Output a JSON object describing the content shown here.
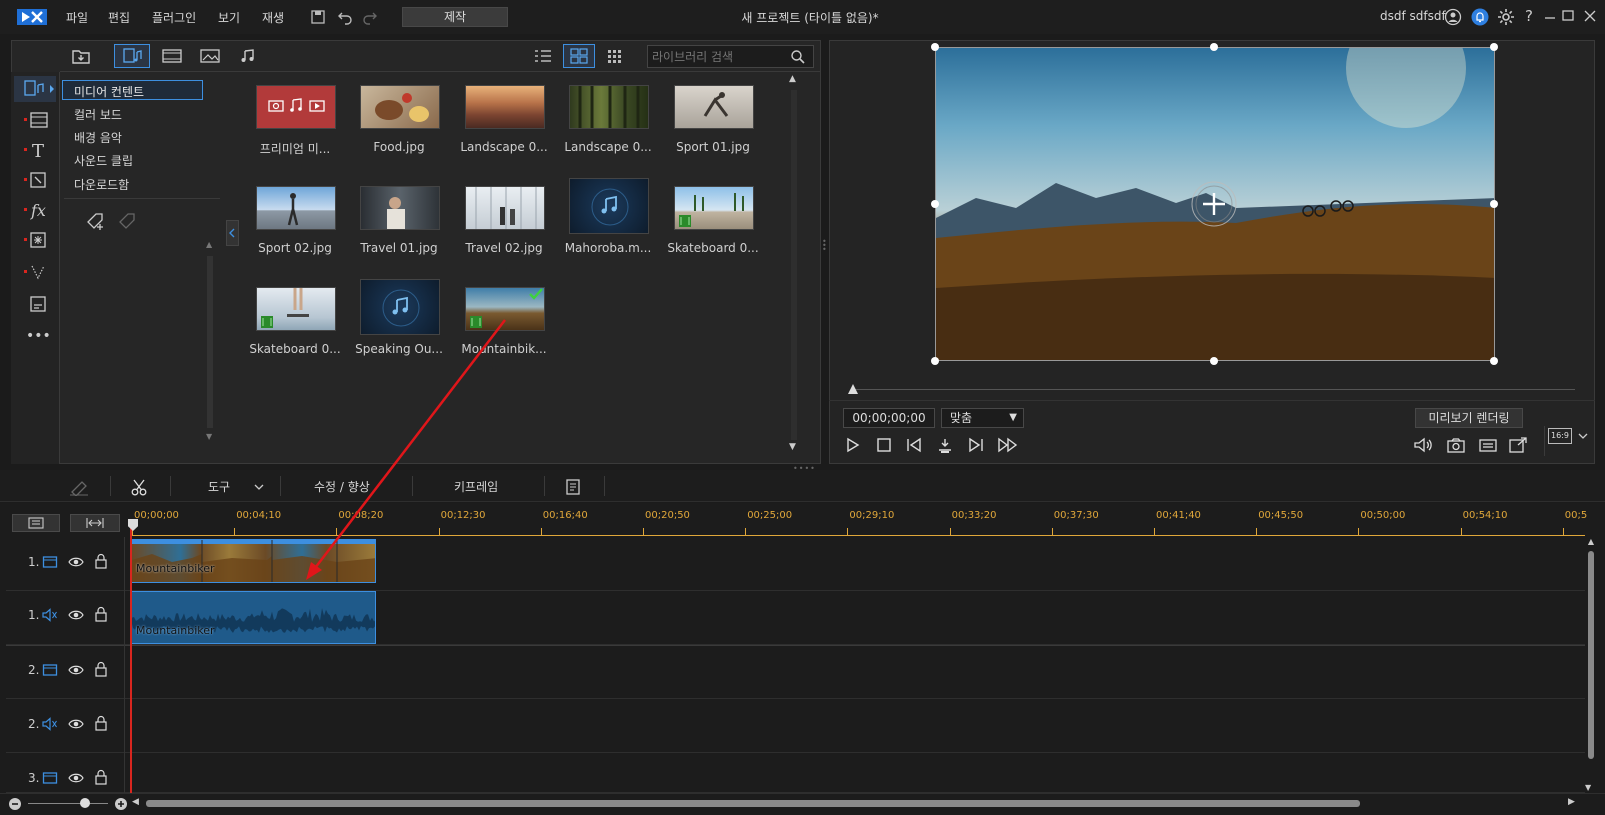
{
  "menu": {
    "items": [
      "파일",
      "편집",
      "플러그인",
      "보기",
      "재생"
    ],
    "produce_button": "제작"
  },
  "window": {
    "title": "새 프로젝트 (타이틀 없음)*",
    "user_name": "dsdf sdfsdf"
  },
  "library": {
    "search_placeholder": "라이브러리 검색",
    "categories": [
      "미디어 컨텐트",
      "컬러 보드",
      "배경 음악",
      "사운드 클립",
      "다운로드함"
    ],
    "items": [
      {
        "label": "프리미엄 미...",
        "kind": "premium"
      },
      {
        "label": "Food.jpg",
        "kind": "image"
      },
      {
        "label": "Landscape 0...",
        "kind": "image"
      },
      {
        "label": "Landscape 0...",
        "kind": "image"
      },
      {
        "label": "Sport 01.jpg",
        "kind": "image"
      },
      {
        "label": "Sport 02.jpg",
        "kind": "image"
      },
      {
        "label": "Travel 01.jpg",
        "kind": "image"
      },
      {
        "label": "Travel 02.jpg",
        "kind": "image"
      },
      {
        "label": "Mahoroba.m...",
        "kind": "audio"
      },
      {
        "label": "Skateboard 0...",
        "kind": "video"
      },
      {
        "label": "Skateboard 0...",
        "kind": "video"
      },
      {
        "label": "Speaking Ou...",
        "kind": "audio"
      },
      {
        "label": "Mountainbik...",
        "kind": "video-used"
      }
    ]
  },
  "preview": {
    "timecode": "00;00;00;00",
    "fit_label": "맞춤",
    "render_button": "미리보기 렌더링",
    "aspect": "16:9"
  },
  "toolbar": {
    "tools_label": "도구",
    "fix_label": "수정 / 향상",
    "keyframe_label": "키프레임"
  },
  "timeline": {
    "ruler": [
      "00;00;00",
      "00;04;10",
      "00;08;20",
      "00;12;30",
      "00;16;40",
      "00;20;50",
      "00;25;00",
      "00;29;10",
      "00;33;20",
      "00;37;30",
      "00;41;40",
      "00;45;50",
      "00;50;00",
      "00;54;10",
      "00;5"
    ],
    "tracks": [
      {
        "number": "1.",
        "type": "video"
      },
      {
        "number": "1.",
        "type": "audio"
      },
      {
        "number": "2.",
        "type": "video"
      },
      {
        "number": "2.",
        "type": "audio"
      },
      {
        "number": "3.",
        "type": "video"
      }
    ],
    "clip_name_video": "Mountainbiker",
    "clip_name_audio": "Mountainbiker"
  },
  "colors": {
    "accent_blue": "#3d8fe0",
    "ruler_orange": "#e0a73a",
    "playhead_red": "#d8261f"
  }
}
